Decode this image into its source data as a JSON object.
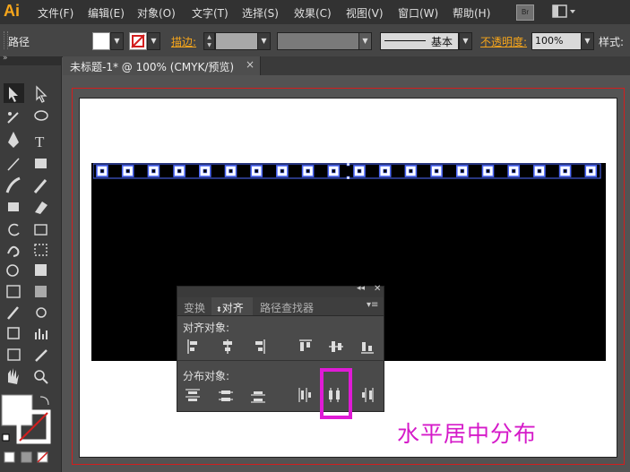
{
  "app": {
    "logo": "Ai"
  },
  "menu": [
    "文件(F)",
    "编辑(E)",
    "对象(O)",
    "文字(T)",
    "选择(S)",
    "效果(C)",
    "视图(V)",
    "窗口(W)",
    "帮助(H)"
  ],
  "bridge_label": "Br",
  "control_bar": {
    "object_type": "路径",
    "stroke_label": "描边:",
    "stroke_style": "基本",
    "opacity_label": "不透明度:",
    "opacity_value": "100%",
    "style_label": "样式:"
  },
  "document_tab": {
    "title": "未标题-1* @ 100% (CMYK/预览)",
    "close": "×"
  },
  "align_panel": {
    "tabs": [
      "变换",
      "对齐",
      "路径查找器"
    ],
    "active_tab": "对齐",
    "align_objects_label": "对齐对象:",
    "distribute_objects_label": "分布对象:",
    "align_buttons": [
      "水平左对齐",
      "水平居中对齐",
      "水平右对齐",
      "垂直顶对齐",
      "垂直居中对齐",
      "垂直底对齐"
    ],
    "distribute_buttons": [
      "垂直顶分布",
      "垂直居中分布",
      "垂直底分布",
      "水平左分布",
      "水平居中分布",
      "水平右分布"
    ]
  },
  "annotation": "水平居中分布",
  "colors": {
    "accent": "#f7a61b",
    "highlight": "#e01bd6",
    "selection": "#4f6bff",
    "guide": "#d21e1e"
  }
}
